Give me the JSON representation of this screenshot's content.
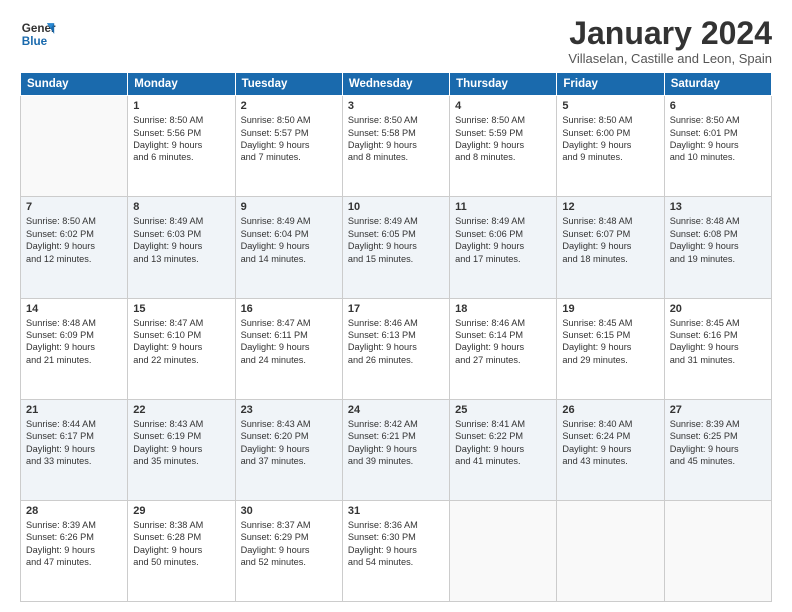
{
  "logo": {
    "line1": "General",
    "line2": "Blue"
  },
  "title": "January 2024",
  "subtitle": "Villaselan, Castille and Leon, Spain",
  "weekdays": [
    "Sunday",
    "Monday",
    "Tuesday",
    "Wednesday",
    "Thursday",
    "Friday",
    "Saturday"
  ],
  "rows": [
    [
      {
        "day": "",
        "text": ""
      },
      {
        "day": "1",
        "text": "Sunrise: 8:50 AM\nSunset: 5:56 PM\nDaylight: 9 hours\nand 6 minutes."
      },
      {
        "day": "2",
        "text": "Sunrise: 8:50 AM\nSunset: 5:57 PM\nDaylight: 9 hours\nand 7 minutes."
      },
      {
        "day": "3",
        "text": "Sunrise: 8:50 AM\nSunset: 5:58 PM\nDaylight: 9 hours\nand 8 minutes."
      },
      {
        "day": "4",
        "text": "Sunrise: 8:50 AM\nSunset: 5:59 PM\nDaylight: 9 hours\nand 8 minutes."
      },
      {
        "day": "5",
        "text": "Sunrise: 8:50 AM\nSunset: 6:00 PM\nDaylight: 9 hours\nand 9 minutes."
      },
      {
        "day": "6",
        "text": "Sunrise: 8:50 AM\nSunset: 6:01 PM\nDaylight: 9 hours\nand 10 minutes."
      }
    ],
    [
      {
        "day": "7",
        "text": "Sunrise: 8:50 AM\nSunset: 6:02 PM\nDaylight: 9 hours\nand 12 minutes."
      },
      {
        "day": "8",
        "text": "Sunrise: 8:49 AM\nSunset: 6:03 PM\nDaylight: 9 hours\nand 13 minutes."
      },
      {
        "day": "9",
        "text": "Sunrise: 8:49 AM\nSunset: 6:04 PM\nDaylight: 9 hours\nand 14 minutes."
      },
      {
        "day": "10",
        "text": "Sunrise: 8:49 AM\nSunset: 6:05 PM\nDaylight: 9 hours\nand 15 minutes."
      },
      {
        "day": "11",
        "text": "Sunrise: 8:49 AM\nSunset: 6:06 PM\nDaylight: 9 hours\nand 17 minutes."
      },
      {
        "day": "12",
        "text": "Sunrise: 8:48 AM\nSunset: 6:07 PM\nDaylight: 9 hours\nand 18 minutes."
      },
      {
        "day": "13",
        "text": "Sunrise: 8:48 AM\nSunset: 6:08 PM\nDaylight: 9 hours\nand 19 minutes."
      }
    ],
    [
      {
        "day": "14",
        "text": "Sunrise: 8:48 AM\nSunset: 6:09 PM\nDaylight: 9 hours\nand 21 minutes."
      },
      {
        "day": "15",
        "text": "Sunrise: 8:47 AM\nSunset: 6:10 PM\nDaylight: 9 hours\nand 22 minutes."
      },
      {
        "day": "16",
        "text": "Sunrise: 8:47 AM\nSunset: 6:11 PM\nDaylight: 9 hours\nand 24 minutes."
      },
      {
        "day": "17",
        "text": "Sunrise: 8:46 AM\nSunset: 6:13 PM\nDaylight: 9 hours\nand 26 minutes."
      },
      {
        "day": "18",
        "text": "Sunrise: 8:46 AM\nSunset: 6:14 PM\nDaylight: 9 hours\nand 27 minutes."
      },
      {
        "day": "19",
        "text": "Sunrise: 8:45 AM\nSunset: 6:15 PM\nDaylight: 9 hours\nand 29 minutes."
      },
      {
        "day": "20",
        "text": "Sunrise: 8:45 AM\nSunset: 6:16 PM\nDaylight: 9 hours\nand 31 minutes."
      }
    ],
    [
      {
        "day": "21",
        "text": "Sunrise: 8:44 AM\nSunset: 6:17 PM\nDaylight: 9 hours\nand 33 minutes."
      },
      {
        "day": "22",
        "text": "Sunrise: 8:43 AM\nSunset: 6:19 PM\nDaylight: 9 hours\nand 35 minutes."
      },
      {
        "day": "23",
        "text": "Sunrise: 8:43 AM\nSunset: 6:20 PM\nDaylight: 9 hours\nand 37 minutes."
      },
      {
        "day": "24",
        "text": "Sunrise: 8:42 AM\nSunset: 6:21 PM\nDaylight: 9 hours\nand 39 minutes."
      },
      {
        "day": "25",
        "text": "Sunrise: 8:41 AM\nSunset: 6:22 PM\nDaylight: 9 hours\nand 41 minutes."
      },
      {
        "day": "26",
        "text": "Sunrise: 8:40 AM\nSunset: 6:24 PM\nDaylight: 9 hours\nand 43 minutes."
      },
      {
        "day": "27",
        "text": "Sunrise: 8:39 AM\nSunset: 6:25 PM\nDaylight: 9 hours\nand 45 minutes."
      }
    ],
    [
      {
        "day": "28",
        "text": "Sunrise: 8:39 AM\nSunset: 6:26 PM\nDaylight: 9 hours\nand 47 minutes."
      },
      {
        "day": "29",
        "text": "Sunrise: 8:38 AM\nSunset: 6:28 PM\nDaylight: 9 hours\nand 50 minutes."
      },
      {
        "day": "30",
        "text": "Sunrise: 8:37 AM\nSunset: 6:29 PM\nDaylight: 9 hours\nand 52 minutes."
      },
      {
        "day": "31",
        "text": "Sunrise: 8:36 AM\nSunset: 6:30 PM\nDaylight: 9 hours\nand 54 minutes."
      },
      {
        "day": "",
        "text": ""
      },
      {
        "day": "",
        "text": ""
      },
      {
        "day": "",
        "text": ""
      }
    ]
  ]
}
